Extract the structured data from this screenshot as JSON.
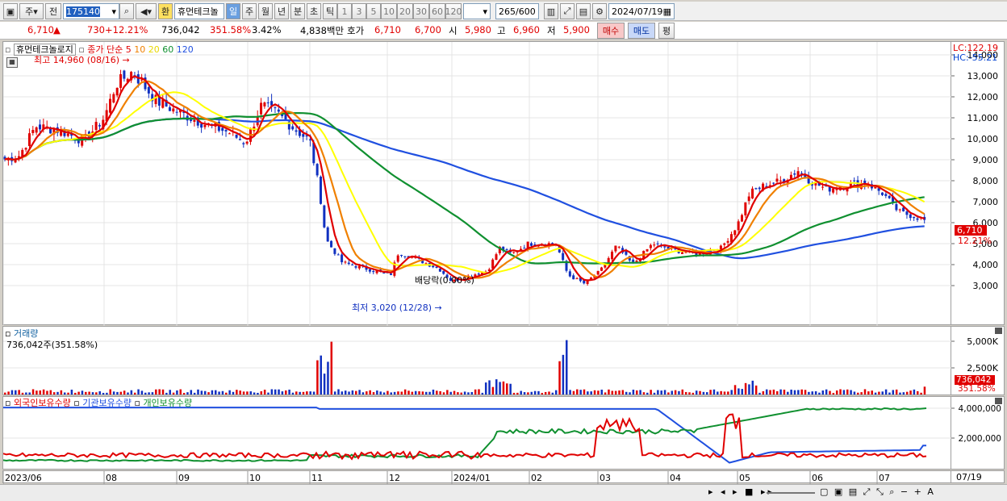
{
  "toolbar": {
    "period_day": "주",
    "prev_label": "전",
    "code": "175140",
    "hwan": "환",
    "stock_name": "휴먼테크놀",
    "periods": [
      "일",
      "주",
      "월",
      "년",
      "분",
      "초",
      "틱"
    ],
    "intervals": [
      "1",
      "3",
      "5",
      "10",
      "20",
      "30",
      "60",
      "120"
    ],
    "count": "265",
    "count_total": "/600",
    "date": "2024/07/19"
  },
  "quote": {
    "price": "6,710",
    "change": "730",
    "change_pct": "+12.21%",
    "volume": "736,042",
    "vol_ratio": "351.58%",
    "turnover": "3.42%",
    "trade_value": "4,838백만",
    "ask_label": "호가",
    "ask1": "6,710",
    "ask2": "6,700",
    "open_label": "시",
    "open": "5,980",
    "high_label": "고",
    "high": "6,960",
    "low_label": "저",
    "low": "5,900",
    "buy": "매수",
    "sell": "매도",
    "avg": "평"
  },
  "legend": {
    "stock": "휴먼테크놀로지",
    "ma_label": "종가 단순",
    "ma_periods": [
      "5",
      "10",
      "20",
      "60",
      "120"
    ],
    "ma_colors": [
      "#e00000",
      "#f08000",
      "#ffff00",
      "#109030",
      "#2050e0"
    ]
  },
  "annotations": {
    "high": "최고 14,960 (08/16)",
    "low": "최저 3,020 (12/28)",
    "dividend": "배당락(0.00%)"
  },
  "right_top": {
    "lc": "LC:122.19",
    "hc": "HC:-55.21",
    "price_tag": "6,710",
    "pct_tag": "12.21%"
  },
  "price_axis": [
    "14,000",
    "13,000",
    "12,000",
    "11,000",
    "10,000",
    "9,000",
    "8,000",
    "7,000",
    "6,000",
    "5,000",
    "4,000",
    "3,000"
  ],
  "volume_panel": {
    "title": "거래량",
    "value": "736,042주(351.58%)",
    "axis": [
      "5,000K",
      "2,500K"
    ],
    "tag": "736,042",
    "tag_pct": "351.58%"
  },
  "holdings_panel": {
    "series": [
      "외국인보유수량",
      "기관보유수량",
      "개인보유수량"
    ],
    "axis": [
      "4,000,000",
      "2,000,000"
    ]
  },
  "date_axis": [
    "2023/06",
    "08",
    "09",
    "10",
    "11",
    "12",
    "2024/01",
    "02",
    "03",
    "04",
    "05",
    "06",
    "07"
  ],
  "end_date": "07/19"
}
